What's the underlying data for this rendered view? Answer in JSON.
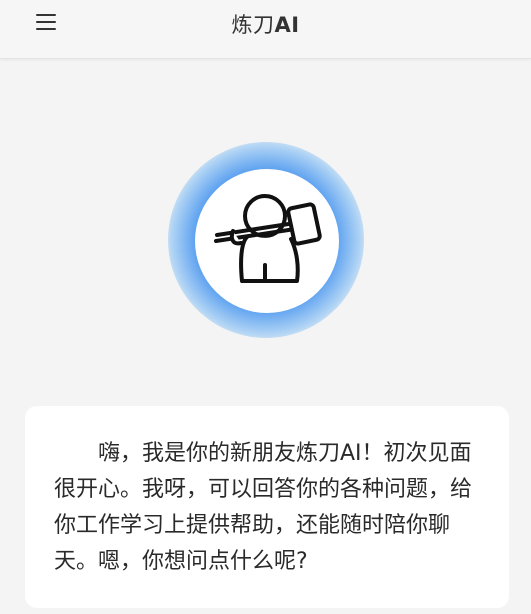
{
  "header": {
    "title_prefix": "炼刀",
    "title_suffix": "AI",
    "menu_icon": "hamburger-menu-icon"
  },
  "avatar": {
    "icon": "blacksmith-hammer-icon",
    "glow_color": "#5aa0f0"
  },
  "greeting": {
    "text": "嗨，我是你的新朋友炼刀AI！初次见面很开心。我呀，可以回答你的各种问题，给你工作学习上提供帮助，还能随时陪你聊天。嗯，你想问点什么呢?"
  }
}
